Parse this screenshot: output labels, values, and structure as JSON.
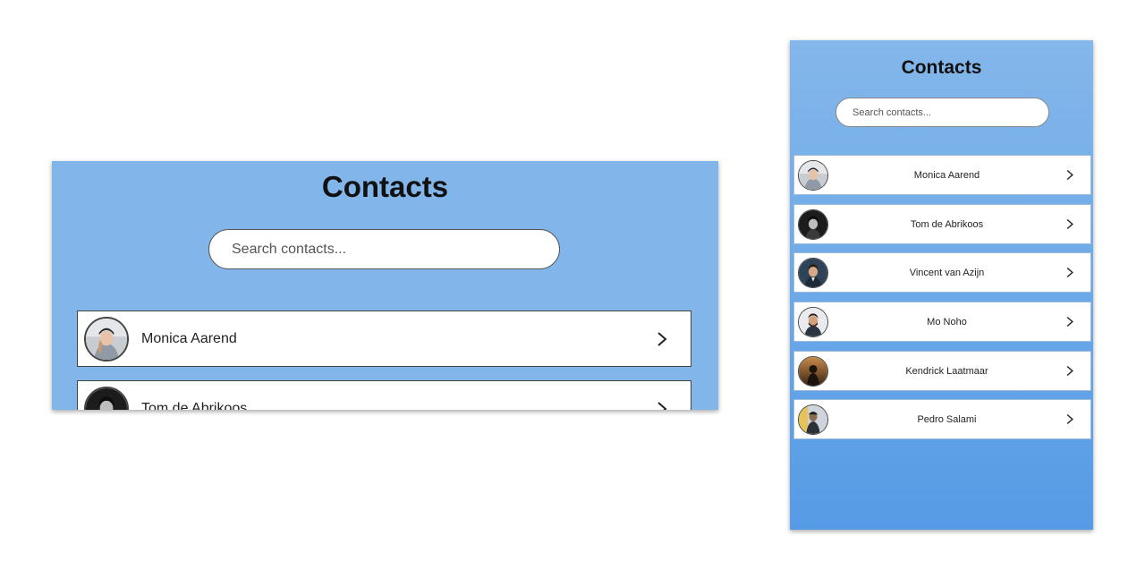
{
  "desktop": {
    "title": "Contacts",
    "search_placeholder": "Search contacts...",
    "contacts": [
      {
        "name": "Monica Aarend"
      },
      {
        "name": "Tom de Abrikoos"
      }
    ]
  },
  "mobile": {
    "title": "Contacts",
    "search_placeholder": "Search contacts...",
    "contacts": [
      {
        "name": "Monica Aarend"
      },
      {
        "name": "Tom de Abrikoos"
      },
      {
        "name": "Vincent van Azijn"
      },
      {
        "name": "Mo Noho"
      },
      {
        "name": "Kendrick Laatmaar"
      },
      {
        "name": "Pedro Salami"
      }
    ]
  },
  "icons": {
    "row_action": "chevron-right-icon",
    "avatar": "avatar-photo"
  },
  "colors": {
    "header_blue": "#82b5e9",
    "mobile_gradient_bottom": "#569be6",
    "row_background": "#ffffff"
  }
}
